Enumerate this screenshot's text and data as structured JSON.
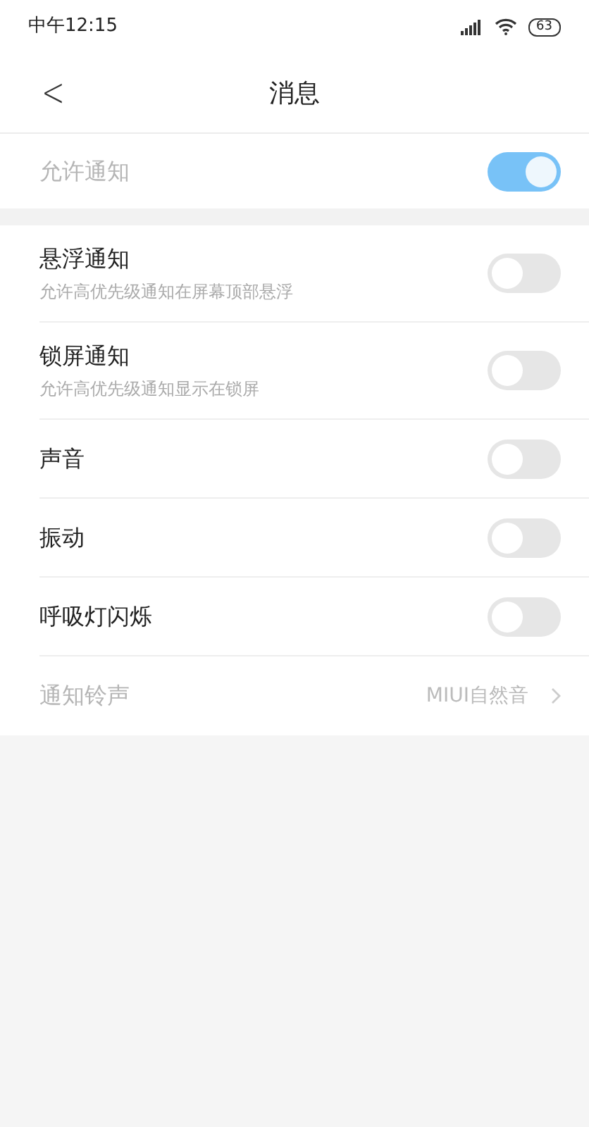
{
  "status_bar": {
    "time": "中午12:15",
    "battery": "63"
  },
  "header": {
    "back": "<",
    "title": "消息"
  },
  "master": {
    "label": "允许通知",
    "on": true,
    "disabled": true
  },
  "settings": [
    {
      "kind": "toggle",
      "label": "悬浮通知",
      "subtitle": "允许高优先级通知在屏幕顶部悬浮",
      "on": false
    },
    {
      "kind": "toggle",
      "label": "锁屏通知",
      "subtitle": "允许高优先级通知显示在锁屏",
      "on": false
    },
    {
      "kind": "toggle",
      "label": "声音",
      "on": false
    },
    {
      "kind": "toggle",
      "label": "振动",
      "on": false
    },
    {
      "kind": "toggle",
      "label": "呼吸灯闪烁",
      "on": false
    },
    {
      "kind": "link",
      "label": "通知铃声",
      "value": "MIUI自然音",
      "disabled": true
    }
  ]
}
